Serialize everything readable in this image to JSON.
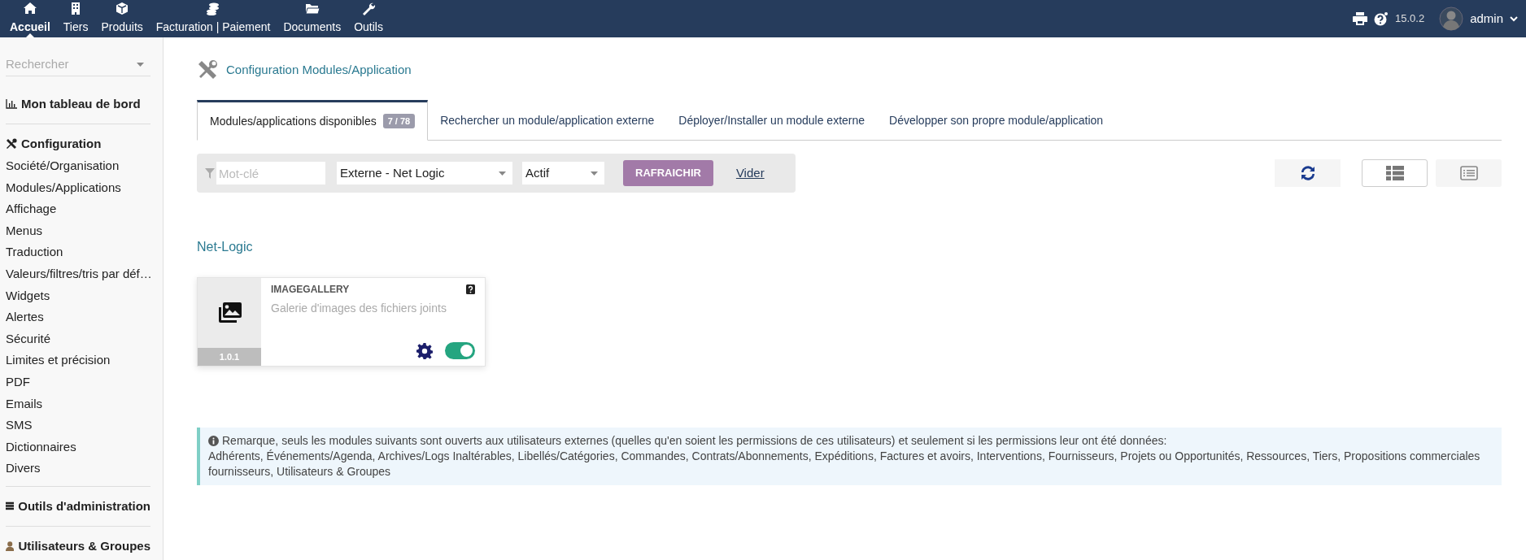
{
  "topbar": {
    "nav_items": [
      {
        "label": "Accueil",
        "selected": true
      },
      {
        "label": "Tiers",
        "selected": false
      },
      {
        "label": "Produits",
        "selected": false
      },
      {
        "label": "Facturation | Paiement",
        "selected": false
      },
      {
        "label": "Documents",
        "selected": false
      },
      {
        "label": "Outils",
        "selected": false
      }
    ],
    "version": "15.0.2",
    "user": "admin"
  },
  "sidebar": {
    "search_placeholder": "Rechercher",
    "sections": [
      {
        "title": "Mon tableau de bord"
      },
      {
        "title": "Configuration",
        "items": [
          "Société/Organisation",
          "Modules/Applications",
          "Affichage",
          "Menus",
          "Traduction",
          "Valeurs/filtres/tris par déf…",
          "Widgets",
          "Alertes",
          "Sécurité",
          "Limites et précision",
          "PDF",
          "Emails",
          "SMS",
          "Dictionnaires",
          "Divers"
        ]
      },
      {
        "title": "Outils d'administration"
      },
      {
        "title": "Utilisateurs & Groupes"
      }
    ]
  },
  "page_title": "Configuration Modules/Application",
  "tabs": [
    {
      "label": "Modules/applications disponibles",
      "badge": "7 / 78",
      "selected": true
    },
    {
      "label": "Rechercher un module/application externe",
      "selected": false
    },
    {
      "label": "Déployer/Installer un module externe",
      "selected": false
    },
    {
      "label": "Développer son propre module/application",
      "selected": false
    }
  ],
  "filters": {
    "keyword_placeholder": "Mot-clé",
    "origin": "Externe - Net Logic",
    "status": "Actif",
    "refresh_button": "RAFRAICHIR",
    "clear_link": "Vider"
  },
  "view_modes": [
    {
      "selected": true
    },
    {
      "selected": false
    }
  ],
  "group_title": "Net-Logic",
  "modules": [
    {
      "name": "IMAGEGALLERY",
      "description": "Galerie d'images des fichiers joints",
      "version": "1.0.1",
      "enabled": true
    }
  ],
  "note": {
    "text": "Remarque, seuls les modules suivants sont ouverts aux utilisateurs externes (quelles qu'en soient les permissions de ces utilisateurs) et seulement si les permissions leur ont été données:",
    "modules_list": "Adhérents, Événements/Agenda, Archives/Logs Inaltérables, Libellés/Catégories, Commandes, Contrats/Abonnements, Expéditions, Factures et avoirs, Interventions, Fournisseurs, Projets ou Opportunités, Ressources, Tiers, Propositions commerciales fournisseurs, Utilisateurs & Groupes"
  }
}
